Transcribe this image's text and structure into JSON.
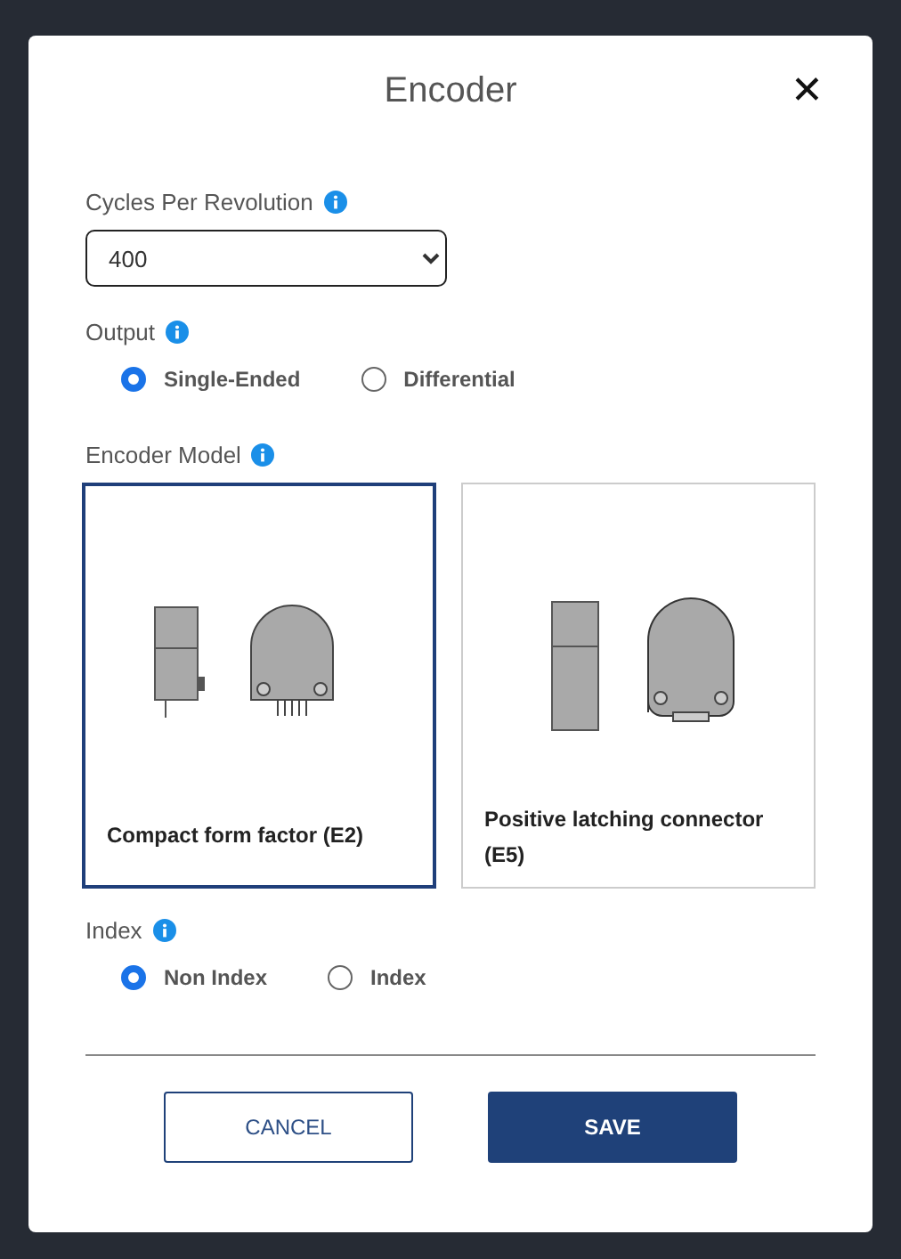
{
  "dialog": {
    "title": "Encoder",
    "close": "✕"
  },
  "cycles": {
    "label": "Cycles Per Revolution",
    "value": "400"
  },
  "output": {
    "label": "Output",
    "options": [
      {
        "label": "Single-Ended",
        "selected": true
      },
      {
        "label": "Differential",
        "selected": false
      }
    ]
  },
  "encoder_model": {
    "label": "Encoder Model",
    "options": [
      {
        "label": "Compact form factor (E2)",
        "selected": true,
        "kind": "compact"
      },
      {
        "label": "Positive latching connector (E5)",
        "selected": false,
        "kind": "latching"
      }
    ]
  },
  "index": {
    "label": "Index",
    "options": [
      {
        "label": "Non Index",
        "selected": true
      },
      {
        "label": "Index",
        "selected": false
      }
    ]
  },
  "buttons": [
    {
      "label": "CANCEL",
      "kind": "secondary"
    },
    {
      "label": "SAVE",
      "kind": "primary"
    }
  ]
}
